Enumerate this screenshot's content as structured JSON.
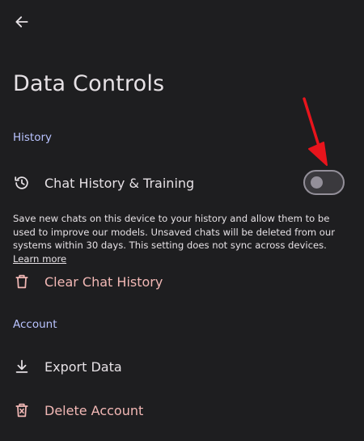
{
  "page": {
    "title": "Data Controls"
  },
  "sections": {
    "history": {
      "header": "History",
      "chat_history": {
        "label": "Chat History & Training",
        "enabled": false
      },
      "description": "Save new chats on this device to your history and allow them to be used to improve our models. Unsaved chats will be deleted from our systems within 30 days. This setting does not sync across devices.",
      "learn_more": "Learn more",
      "clear_history": "Clear Chat History"
    },
    "account": {
      "header": "Account",
      "export_data": "Export Data",
      "delete_account": "Delete Account"
    }
  },
  "icons": {
    "back": "arrow-left-icon",
    "history": "history-icon",
    "clear": "trash-icon",
    "export": "download-icon",
    "delete": "trash-x-icon"
  },
  "colors": {
    "background": "#1e1e20",
    "section_header": "#b9c3ff",
    "danger_text": "#f2b8b5",
    "annotation_arrow": "#e8141c"
  }
}
